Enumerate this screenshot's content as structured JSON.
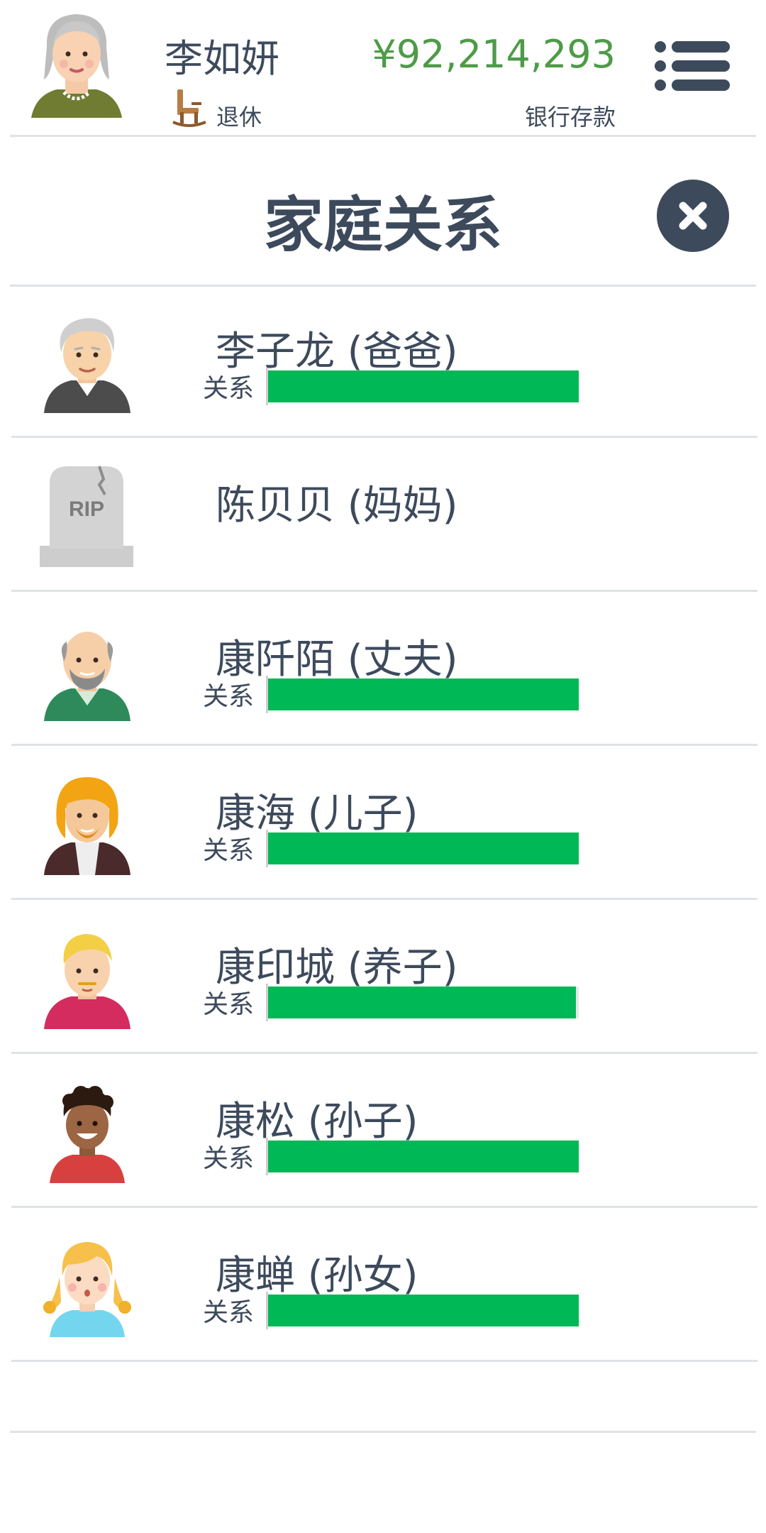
{
  "header": {
    "player_name": "李如妍",
    "status_label": "退休",
    "bank_balance": "¥92,214,293",
    "bank_label": "银行存款"
  },
  "section": {
    "title": "家庭关系"
  },
  "family": {
    "relation_label": "关系",
    "members": [
      {
        "name": "李子龙 (爸爸)",
        "relationship": 1.0,
        "deceased": false,
        "avatar": "elderly-man-avatar-icon"
      },
      {
        "name": "陈贝贝 (妈妈)",
        "relationship": null,
        "deceased": true,
        "avatar": "rip-tombstone-icon",
        "tombstone_text": "RIP"
      },
      {
        "name": "康阡陌 (丈夫)",
        "relationship": 1.0,
        "deceased": false,
        "avatar": "bald-bearded-man-avatar-icon"
      },
      {
        "name": "康海 (儿子)",
        "relationship": 1.0,
        "deceased": false,
        "avatar": "blond-bearded-man-avatar-icon"
      },
      {
        "name": "康印城 (养子)",
        "relationship": 0.99,
        "deceased": false,
        "avatar": "blond-young-man-avatar-icon"
      },
      {
        "name": "康松 (孙子)",
        "relationship": 1.0,
        "deceased": false,
        "avatar": "curly-haired-boy-avatar-icon"
      },
      {
        "name": "康蝉 (孙女)",
        "relationship": 1.0,
        "deceased": false,
        "avatar": "blonde-girl-avatar-icon"
      }
    ]
  },
  "colors": {
    "text": "#3d4a5c",
    "money": "#4e9b47",
    "relation_bar": "#00b856",
    "divider": "#dfe2e6"
  }
}
